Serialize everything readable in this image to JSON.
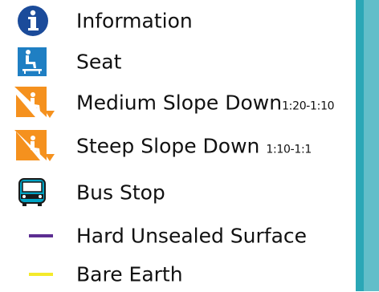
{
  "legend": {
    "items": [
      {
        "icon": "info-icon",
        "label": "Information"
      },
      {
        "icon": "seat-icon",
        "label": "Seat"
      },
      {
        "icon": "medium-slope-down-icon",
        "label": "Medium Slope Down",
        "range": "1:20-1:10"
      },
      {
        "icon": "steep-slope-down-icon",
        "label": "Steep Slope Down",
        "range": "1:10-1:1"
      },
      {
        "icon": "bus-stop-icon",
        "label": "Bus Stop"
      },
      {
        "icon": "hard-unsealed-surface-line",
        "label": "Hard Unsealed Surface",
        "color": "#5c2d91"
      },
      {
        "icon": "bare-earth-line",
        "label": "Bare Earth",
        "color": "#f4ea2a"
      }
    ]
  },
  "colors": {
    "info_blue": "#1b4b9a",
    "seat_blue": "#1f7fc3",
    "slope_orange": "#f5911e",
    "bus_teal": "#00a3c4",
    "band_dark": "#2aa7b6",
    "band_light": "#61bec9"
  }
}
